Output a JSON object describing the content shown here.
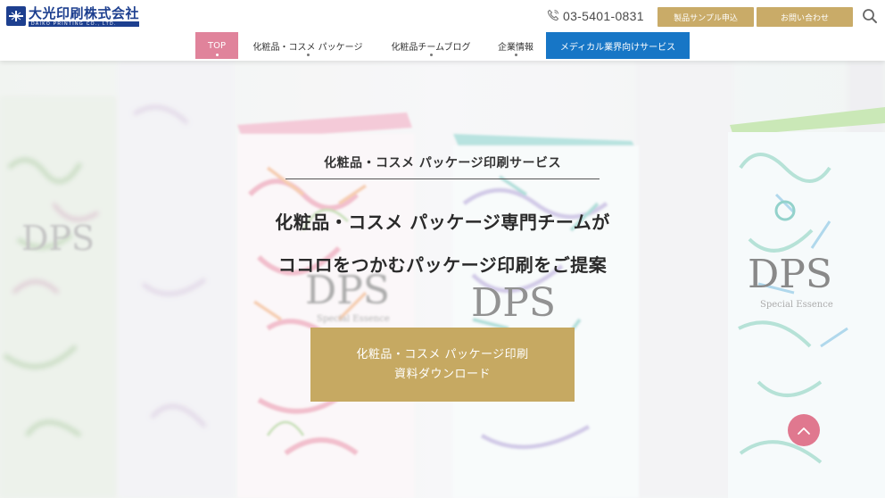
{
  "header": {
    "logo": {
      "company_name": "大光印刷株式会社",
      "english_name": "DAIKO PRINTING CO., LTD."
    },
    "phone": {
      "number": "03-5401-0831",
      "icon": "phone-icon"
    },
    "buttons": {
      "sample": "製品サンプル申込",
      "contact": "お問い合わせ"
    },
    "search_icon": "search-icon"
  },
  "nav": {
    "items": [
      {
        "label": "TOP",
        "active": true
      },
      {
        "label": "化粧品・コスメ パッケージ"
      },
      {
        "label": "化粧品チームブログ"
      },
      {
        "label": "企業情報"
      },
      {
        "label": "メディカル業界向けサービス"
      }
    ]
  },
  "hero": {
    "subtitle": "化粧品・コスメ パッケージ印刷サービス",
    "headline_line1": "化粧品・コスメ パッケージ専門チームが",
    "headline_line2": "ココロをつかむパッケージ印刷をご提案",
    "cta": {
      "line1": "化粧品・コスメ パッケージ印刷",
      "line2": "資料ダウンロード"
    },
    "box_brand": "DPS",
    "box_tagline": "Special Essence"
  },
  "colors": {
    "brand_blue": "#1d3f8f",
    "gold": "#c6a962",
    "pink_active": "#e0839b",
    "medical_blue": "#1776c6",
    "scroll_top": "#e0788f"
  },
  "scroll_top_icon": "chevron-up-icon"
}
